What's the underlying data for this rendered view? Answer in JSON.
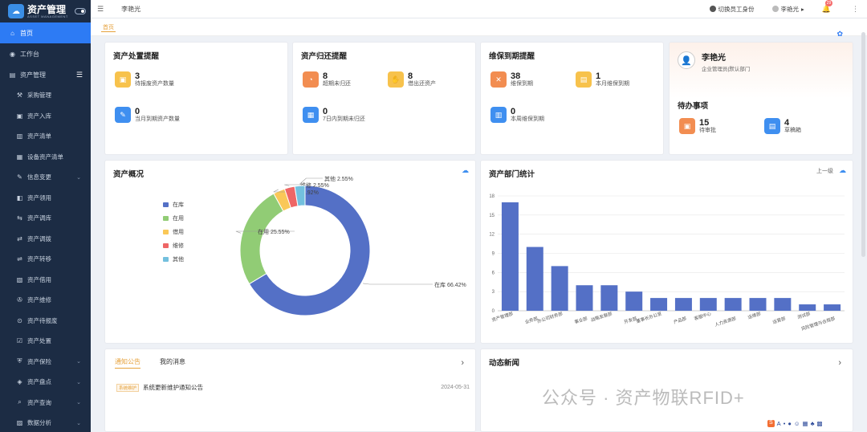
{
  "sidebar": {
    "logo_title": "资产管理",
    "logo_sub": "ASSET MANAGEMENT",
    "items": [
      {
        "label": "首页",
        "icon": "home-icon",
        "active": true
      },
      {
        "label": "工作台",
        "icon": "dashboard-icon"
      },
      {
        "label": "资产管理",
        "icon": "asset-icon"
      },
      {
        "label": "采购管理",
        "icon": "cart-icon"
      },
      {
        "label": "资产入库",
        "icon": "inbound-icon"
      },
      {
        "label": "资产清单",
        "icon": "list-icon"
      },
      {
        "label": "设备资产清单",
        "icon": "device-list-icon"
      },
      {
        "label": "信息变更",
        "icon": "edit-icon"
      },
      {
        "label": "资产领用",
        "icon": "receive-icon"
      },
      {
        "label": "资产调库",
        "icon": "transfer-icon"
      },
      {
        "label": "资产调拨",
        "icon": "allocate-icon"
      },
      {
        "label": "资产转移",
        "icon": "move-icon"
      },
      {
        "label": "资产借用",
        "icon": "borrow-icon"
      },
      {
        "label": "资产维修",
        "icon": "repair-icon"
      },
      {
        "label": "资产待报废",
        "icon": "scrap-pending-icon"
      },
      {
        "label": "资产处置",
        "icon": "dispose-icon"
      },
      {
        "label": "资产保险",
        "icon": "insurance-icon"
      },
      {
        "label": "资产盘点",
        "icon": "inventory-icon"
      },
      {
        "label": "资产查询",
        "icon": "query-icon"
      },
      {
        "label": "数据分析",
        "icon": "analysis-icon"
      }
    ]
  },
  "topbar": {
    "breadcrumb": "李艳光",
    "switch_role": "切换员工身份",
    "user": "李艳光",
    "notif_count": "29"
  },
  "tabs": {
    "home": "首页"
  },
  "cards": {
    "disposal": {
      "title": "资产处置提醒",
      "stats": [
        {
          "num": "3",
          "label": "待报废资产数量"
        },
        {
          "num": "0",
          "label": "当月到期资产数量"
        }
      ]
    },
    "return": {
      "title": "资产归还提醒",
      "stats": [
        {
          "num": "8",
          "label": "超期未归还"
        },
        {
          "num": "8",
          "label": "借出还资产"
        },
        {
          "num": "0",
          "label": "7日内到期未归还"
        }
      ]
    },
    "maintenance": {
      "title": "维保到期提醒",
      "stats": [
        {
          "num": "38",
          "label": "维保到期"
        },
        {
          "num": "1",
          "label": "本月维保到期"
        },
        {
          "num": "0",
          "label": "本周维保到期"
        }
      ]
    },
    "profile": {
      "name": "李艳光",
      "dept": "企业管理员|默认部门",
      "todo_title": "待办事项",
      "todos": [
        {
          "num": "15",
          "label": "待审批"
        },
        {
          "num": "4",
          "label": "草稿箱"
        }
      ]
    }
  },
  "overview": {
    "title": "资产概况"
  },
  "dept_stats": {
    "title": "资产部门统计",
    "level_up": "上一级"
  },
  "notice": {
    "tab_notice": "通知公告",
    "tab_messages": "我的消息",
    "row_tag": "系统维护",
    "row_title": "系统更新维护通知公告",
    "row_date": "2024-05-31"
  },
  "news": {
    "title": "动态新闻"
  },
  "watermark": "公众号 · 资产物联RFID+",
  "colors": {
    "accent": "#2d7bf4",
    "sidebar": "#1c2c44",
    "bar": "#5470c6"
  },
  "chart_data": [
    {
      "type": "pie",
      "categories": [
        "在库",
        "在用",
        "借用",
        "维修",
        "其他"
      ],
      "values": [
        66.42,
        25.55,
        2.92,
        2.55,
        2.55
      ],
      "labels": [
        "在库 66.42%",
        "在用 25.55%",
        "借用 2.92%",
        "维修 2.55%",
        "其他 2.55%"
      ],
      "colors": [
        "#5470c6",
        "#91cc75",
        "#fac858",
        "#ee6666",
        "#73c0de"
      ],
      "legend": "left"
    },
    {
      "type": "bar",
      "categories": [
        "资产管理部",
        "业务部",
        "办公司财务部",
        "事业部",
        "战略发展部",
        "开发部",
        "董事长办公室",
        "产品部",
        "客服中心",
        "人力资源部",
        "运维部",
        "运营部",
        "测试部",
        "风险管理与合规部"
      ],
      "values": [
        17,
        10,
        7,
        4,
        4,
        3,
        2,
        2,
        2,
        2,
        2,
        2,
        1,
        1
      ],
      "ylim": [
        0,
        18
      ],
      "yticks": [
        0,
        3,
        6,
        9,
        12,
        15,
        18
      ],
      "grid": true
    }
  ]
}
